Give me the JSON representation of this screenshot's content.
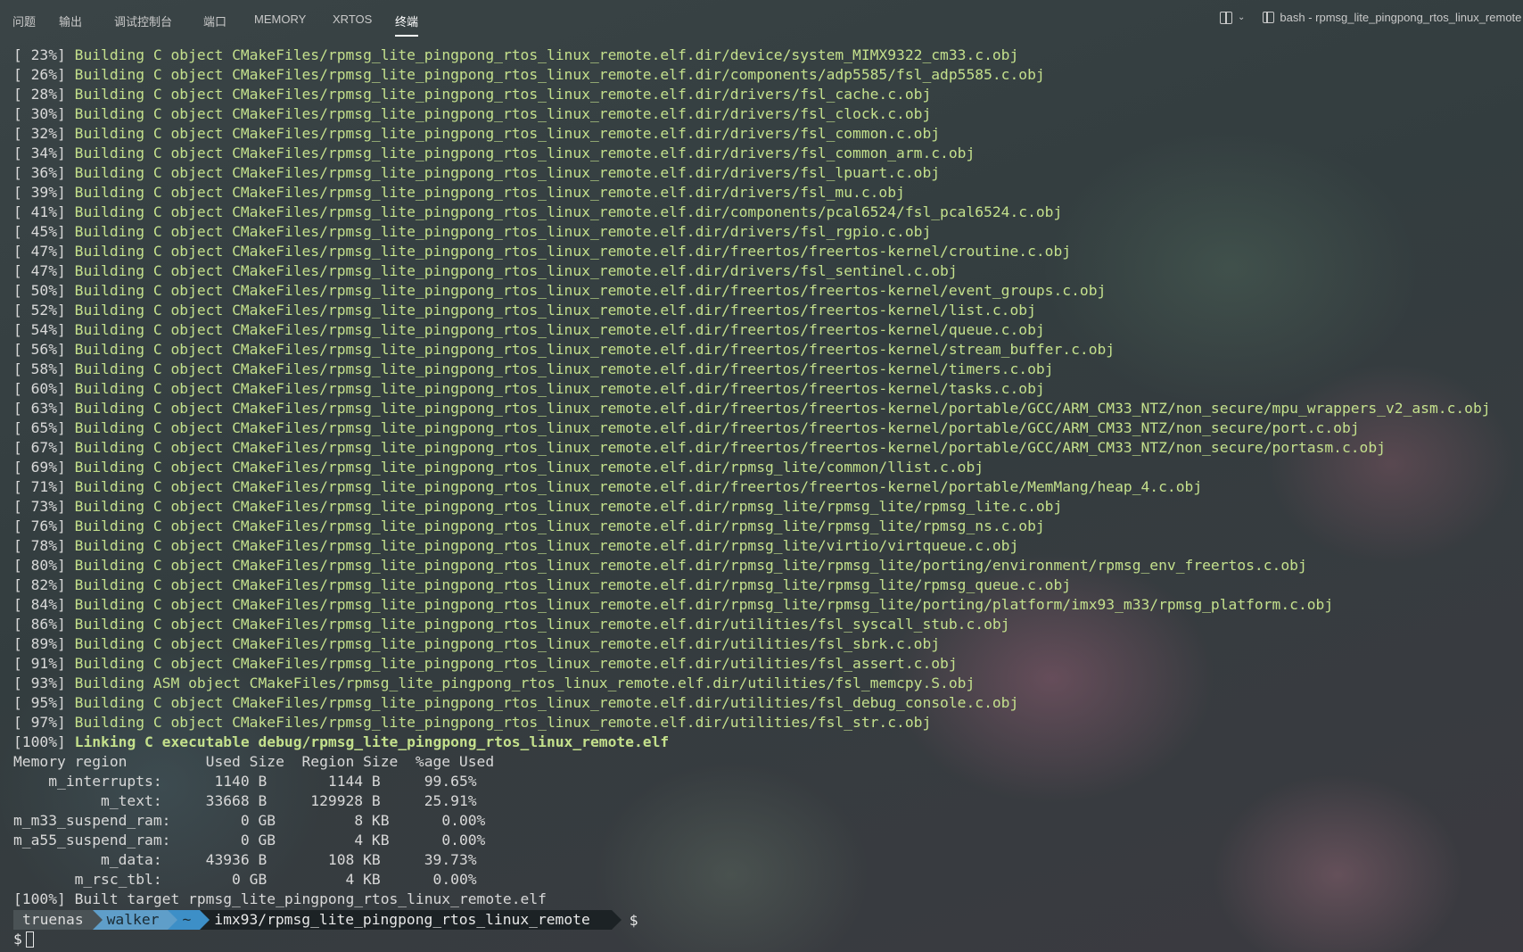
{
  "panel_tabs": [
    {
      "label": "问题"
    },
    {
      "label": "输出"
    },
    {
      "label": "调试控制台"
    },
    {
      "label": "端口"
    },
    {
      "label": "MEMORY"
    },
    {
      "label": "XRTOS"
    },
    {
      "label": "终端"
    }
  ],
  "active_tab": "终端",
  "terminal_title": "bash - rpmsg_lite_pingpong_rtos_linux_remote",
  "build_lines": [
    {
      "pct": "[ 23%]",
      "text": "Building C object CMakeFiles/rpmsg_lite_pingpong_rtos_linux_remote.elf.dir/device/system_MIMX9322_cm33.c.obj"
    },
    {
      "pct": "[ 26%]",
      "text": "Building C object CMakeFiles/rpmsg_lite_pingpong_rtos_linux_remote.elf.dir/components/adp5585/fsl_adp5585.c.obj"
    },
    {
      "pct": "[ 28%]",
      "text": "Building C object CMakeFiles/rpmsg_lite_pingpong_rtos_linux_remote.elf.dir/drivers/fsl_cache.c.obj"
    },
    {
      "pct": "[ 30%]",
      "text": "Building C object CMakeFiles/rpmsg_lite_pingpong_rtos_linux_remote.elf.dir/drivers/fsl_clock.c.obj"
    },
    {
      "pct": "[ 32%]",
      "text": "Building C object CMakeFiles/rpmsg_lite_pingpong_rtos_linux_remote.elf.dir/drivers/fsl_common.c.obj"
    },
    {
      "pct": "[ 34%]",
      "text": "Building C object CMakeFiles/rpmsg_lite_pingpong_rtos_linux_remote.elf.dir/drivers/fsl_common_arm.c.obj"
    },
    {
      "pct": "[ 36%]",
      "text": "Building C object CMakeFiles/rpmsg_lite_pingpong_rtos_linux_remote.elf.dir/drivers/fsl_lpuart.c.obj"
    },
    {
      "pct": "[ 39%]",
      "text": "Building C object CMakeFiles/rpmsg_lite_pingpong_rtos_linux_remote.elf.dir/drivers/fsl_mu.c.obj"
    },
    {
      "pct": "[ 41%]",
      "text": "Building C object CMakeFiles/rpmsg_lite_pingpong_rtos_linux_remote.elf.dir/components/pcal6524/fsl_pcal6524.c.obj"
    },
    {
      "pct": "[ 45%]",
      "text": "Building C object CMakeFiles/rpmsg_lite_pingpong_rtos_linux_remote.elf.dir/drivers/fsl_rgpio.c.obj"
    },
    {
      "pct": "[ 47%]",
      "text": "Building C object CMakeFiles/rpmsg_lite_pingpong_rtos_linux_remote.elf.dir/freertos/freertos-kernel/croutine.c.obj"
    },
    {
      "pct": "[ 47%]",
      "text": "Building C object CMakeFiles/rpmsg_lite_pingpong_rtos_linux_remote.elf.dir/drivers/fsl_sentinel.c.obj"
    },
    {
      "pct": "[ 50%]",
      "text": "Building C object CMakeFiles/rpmsg_lite_pingpong_rtos_linux_remote.elf.dir/freertos/freertos-kernel/event_groups.c.obj"
    },
    {
      "pct": "[ 52%]",
      "text": "Building C object CMakeFiles/rpmsg_lite_pingpong_rtos_linux_remote.elf.dir/freertos/freertos-kernel/list.c.obj"
    },
    {
      "pct": "[ 54%]",
      "text": "Building C object CMakeFiles/rpmsg_lite_pingpong_rtos_linux_remote.elf.dir/freertos/freertos-kernel/queue.c.obj"
    },
    {
      "pct": "[ 56%]",
      "text": "Building C object CMakeFiles/rpmsg_lite_pingpong_rtos_linux_remote.elf.dir/freertos/freertos-kernel/stream_buffer.c.obj"
    },
    {
      "pct": "[ 58%]",
      "text": "Building C object CMakeFiles/rpmsg_lite_pingpong_rtos_linux_remote.elf.dir/freertos/freertos-kernel/timers.c.obj"
    },
    {
      "pct": "[ 60%]",
      "text": "Building C object CMakeFiles/rpmsg_lite_pingpong_rtos_linux_remote.elf.dir/freertos/freertos-kernel/tasks.c.obj"
    },
    {
      "pct": "[ 63%]",
      "text": "Building C object CMakeFiles/rpmsg_lite_pingpong_rtos_linux_remote.elf.dir/freertos/freertos-kernel/portable/GCC/ARM_CM33_NTZ/non_secure/mpu_wrappers_v2_asm.c.obj"
    },
    {
      "pct": "[ 65%]",
      "text": "Building C object CMakeFiles/rpmsg_lite_pingpong_rtos_linux_remote.elf.dir/freertos/freertos-kernel/portable/GCC/ARM_CM33_NTZ/non_secure/port.c.obj"
    },
    {
      "pct": "[ 67%]",
      "text": "Building C object CMakeFiles/rpmsg_lite_pingpong_rtos_linux_remote.elf.dir/freertos/freertos-kernel/portable/GCC/ARM_CM33_NTZ/non_secure/portasm.c.obj"
    },
    {
      "pct": "[ 69%]",
      "text": "Building C object CMakeFiles/rpmsg_lite_pingpong_rtos_linux_remote.elf.dir/rpmsg_lite/common/llist.c.obj"
    },
    {
      "pct": "[ 71%]",
      "text": "Building C object CMakeFiles/rpmsg_lite_pingpong_rtos_linux_remote.elf.dir/freertos/freertos-kernel/portable/MemMang/heap_4.c.obj"
    },
    {
      "pct": "[ 73%]",
      "text": "Building C object CMakeFiles/rpmsg_lite_pingpong_rtos_linux_remote.elf.dir/rpmsg_lite/rpmsg_lite/rpmsg_lite.c.obj"
    },
    {
      "pct": "[ 76%]",
      "text": "Building C object CMakeFiles/rpmsg_lite_pingpong_rtos_linux_remote.elf.dir/rpmsg_lite/rpmsg_lite/rpmsg_ns.c.obj"
    },
    {
      "pct": "[ 78%]",
      "text": "Building C object CMakeFiles/rpmsg_lite_pingpong_rtos_linux_remote.elf.dir/rpmsg_lite/virtio/virtqueue.c.obj"
    },
    {
      "pct": "[ 80%]",
      "text": "Building C object CMakeFiles/rpmsg_lite_pingpong_rtos_linux_remote.elf.dir/rpmsg_lite/rpmsg_lite/porting/environment/rpmsg_env_freertos.c.obj"
    },
    {
      "pct": "[ 82%]",
      "text": "Building C object CMakeFiles/rpmsg_lite_pingpong_rtos_linux_remote.elf.dir/rpmsg_lite/rpmsg_lite/rpmsg_queue.c.obj"
    },
    {
      "pct": "[ 84%]",
      "text": "Building C object CMakeFiles/rpmsg_lite_pingpong_rtos_linux_remote.elf.dir/rpmsg_lite/rpmsg_lite/porting/platform/imx93_m33/rpmsg_platform.c.obj"
    },
    {
      "pct": "[ 86%]",
      "text": "Building C object CMakeFiles/rpmsg_lite_pingpong_rtos_linux_remote.elf.dir/utilities/fsl_syscall_stub.c.obj"
    },
    {
      "pct": "[ 89%]",
      "text": "Building C object CMakeFiles/rpmsg_lite_pingpong_rtos_linux_remote.elf.dir/utilities/fsl_sbrk.c.obj"
    },
    {
      "pct": "[ 91%]",
      "text": "Building C object CMakeFiles/rpmsg_lite_pingpong_rtos_linux_remote.elf.dir/utilities/fsl_assert.c.obj"
    },
    {
      "pct": "[ 93%]",
      "text": "Building ASM object CMakeFiles/rpmsg_lite_pingpong_rtos_linux_remote.elf.dir/utilities/fsl_memcpy.S.obj"
    },
    {
      "pct": "[ 95%]",
      "text": "Building C object CMakeFiles/rpmsg_lite_pingpong_rtos_linux_remote.elf.dir/utilities/fsl_debug_console.c.obj"
    },
    {
      "pct": "[ 97%]",
      "text": "Building C object CMakeFiles/rpmsg_lite_pingpong_rtos_linux_remote.elf.dir/utilities/fsl_str.c.obj"
    }
  ],
  "link_line": {
    "pct": "[100%]",
    "text": "Linking C executable debug/rpmsg_lite_pingpong_rtos_linux_remote.elf"
  },
  "memory_header": "Memory region         Used Size  Region Size  %age Used",
  "memory_rows": [
    {
      "region": "    m_interrupts:",
      "used": "1140 B",
      "size": "1144 B",
      "pct": "99.65%"
    },
    {
      "region": "          m_text:",
      "used": "33668 B",
      "size": "129928 B",
      "pct": "25.91%"
    },
    {
      "region": "m_m33_suspend_ram:",
      "used": "0 GB",
      "size": "8 KB",
      "pct": "0.00%"
    },
    {
      "region": "m_a55_suspend_ram:",
      "used": "0 GB",
      "size": "4 KB",
      "pct": "0.00%"
    },
    {
      "region": "          m_data:",
      "used": "43936 B",
      "size": "108 KB",
      "pct": "39.73%"
    },
    {
      "region": "       m_rsc_tbl:",
      "used": "0 GB",
      "size": "4 KB",
      "pct": "0.00%"
    }
  ],
  "built_line": "[100%] Built target rpmsg_lite_pingpong_rtos_linux_remote.elf",
  "prompt": {
    "host": "truenas",
    "user": "walker",
    "home": "~",
    "path": "imx93/rpmsg_lite_pingpong_rtos_linux_remote",
    "symbol": "$"
  },
  "input_prompt": "$",
  "colors": {
    "build_text": "#c4e08c",
    "default_text": "#d8d8d8"
  }
}
